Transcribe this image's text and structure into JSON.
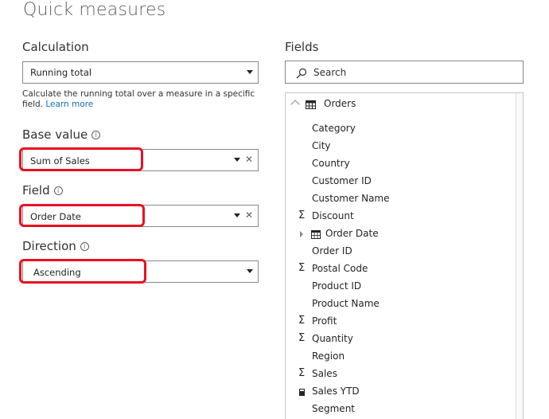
{
  "title": "Quick measures",
  "calculation": {
    "label": "Calculation",
    "value": "Running total",
    "description": "Calculate the running total over a measure in a specific field.",
    "learn_more": "Learn more"
  },
  "base_value": {
    "label": "Base value",
    "value": "Sum of Sales"
  },
  "field": {
    "label": "Field",
    "value": "Order Date"
  },
  "direction": {
    "label": "Direction",
    "value": "Ascending"
  },
  "fields_panel": {
    "label": "Fields",
    "search_placeholder": "Search",
    "table_name": "Orders",
    "items": [
      {
        "label": "Category",
        "icon": "none"
      },
      {
        "label": "City",
        "icon": "none"
      },
      {
        "label": "Country",
        "icon": "none"
      },
      {
        "label": "Customer ID",
        "icon": "none"
      },
      {
        "label": "Customer Name",
        "icon": "none"
      },
      {
        "label": "Discount",
        "icon": "sigma-icon"
      },
      {
        "label": "Order Date",
        "icon": "calendar-icon"
      },
      {
        "label": "Order ID",
        "icon": "none"
      },
      {
        "label": "Postal Code",
        "icon": "sigma-icon"
      },
      {
        "label": "Product ID",
        "icon": "none"
      },
      {
        "label": "Product Name",
        "icon": "none"
      },
      {
        "label": "Profit",
        "icon": "sigma-icon"
      },
      {
        "label": "Quantity",
        "icon": "sigma-icon"
      },
      {
        "label": "Region",
        "icon": "none"
      },
      {
        "label": "Sales",
        "icon": "sigma-icon"
      },
      {
        "label": "Sales YTD",
        "icon": "calculator-icon"
      },
      {
        "label": "Segment",
        "icon": "none"
      }
    ]
  },
  "colors": {
    "highlight": "#e81123",
    "link": "#106ebe",
    "border": "#8a8886"
  }
}
